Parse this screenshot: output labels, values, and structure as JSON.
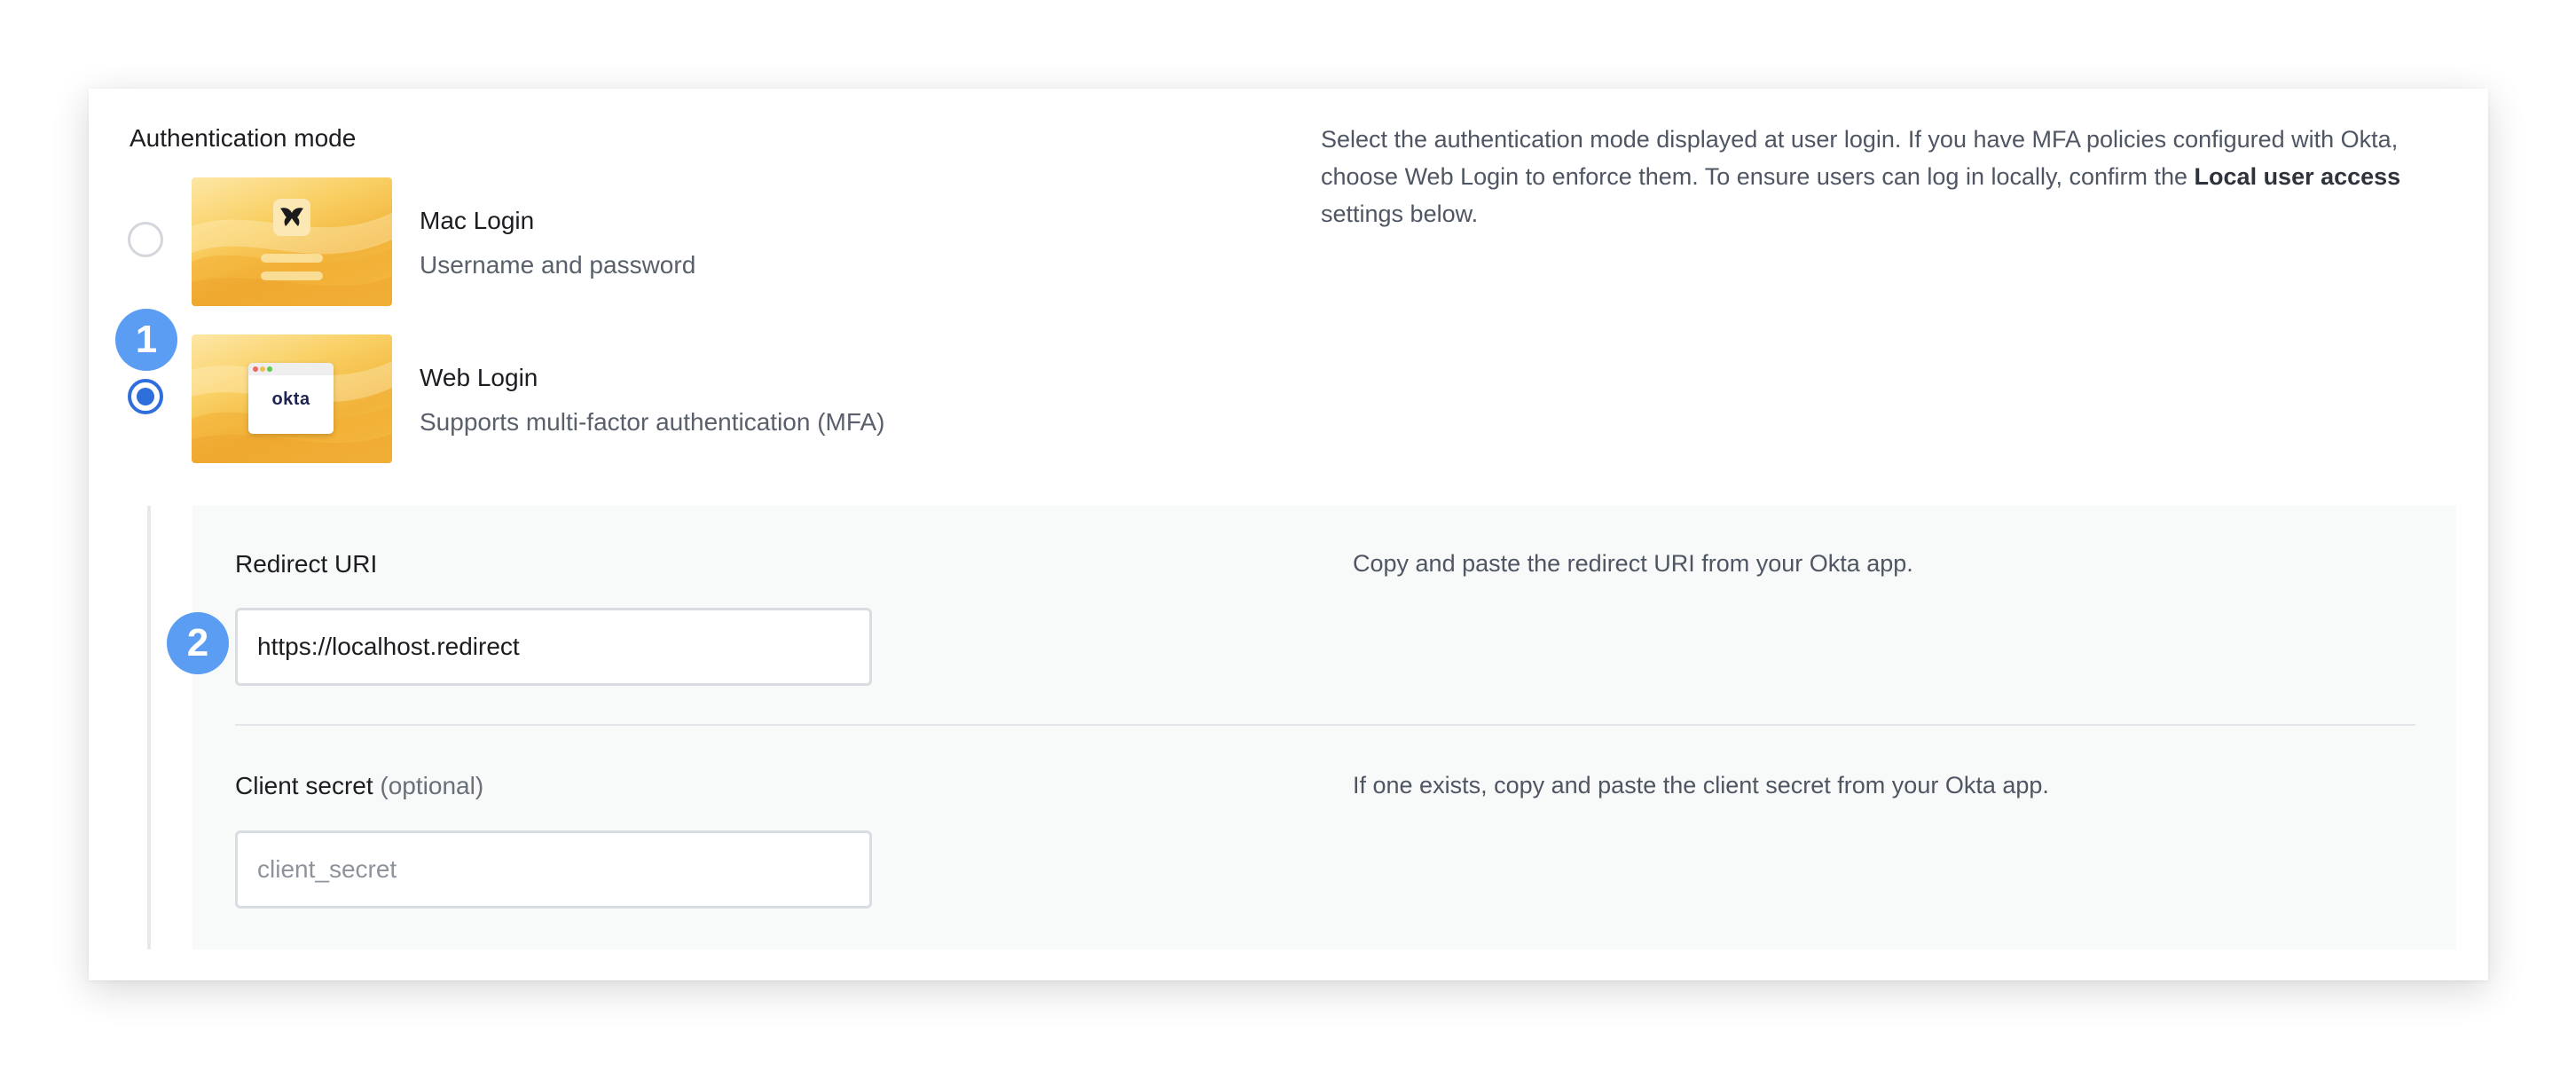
{
  "auth": {
    "title": "Authentication mode",
    "description_main": "Select the authentication mode displayed at user login. If you have MFA policies configured with Okta, choose Web Login to enforce them. To ensure users can log in locally, confirm the ",
    "description_bold": "Local user access",
    "description_end": " settings below.",
    "options": [
      {
        "title": "Mac Login",
        "subtitle": "Username and password",
        "selected": false
      },
      {
        "title": "Web Login",
        "subtitle": "Supports multi-factor authentication (MFA)",
        "selected": true,
        "thumbnail_logo": "okta"
      }
    ]
  },
  "callouts": [
    "1",
    "2"
  ],
  "redirect": {
    "label": "Redirect URI",
    "help": "Copy and paste the redirect URI from your Okta app.",
    "value": "https://localhost.redirect"
  },
  "client_secret": {
    "label": "Client secret",
    "optional": "(optional)",
    "help": "If one exists, copy and paste the client secret from your Okta app.",
    "value": "",
    "placeholder": "client_secret"
  },
  "colors": {
    "accent": "#2f6fdc",
    "callout": "#5b9df2",
    "thumbnail": "#f4b942"
  },
  "icons": {
    "mac_tile": "jamf-logo-icon",
    "radio_checked": "radio-checked",
    "radio_unchecked": "radio-unchecked"
  }
}
